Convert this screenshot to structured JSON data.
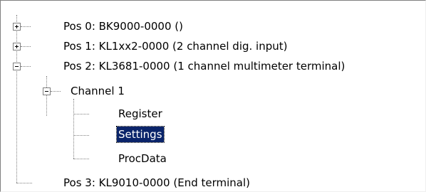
{
  "tree": {
    "nodes": [
      {
        "label": "Pos 0: BK9000-0000  ()",
        "expander": "plus"
      },
      {
        "label": "Pos 1: KL1xx2-0000  (2 channel dig. input)",
        "expander": "plus"
      },
      {
        "label": "Pos 2: KL3681-0000  (1 channel multimeter terminal)",
        "expander": "minus"
      },
      {
        "label": "Channel 1",
        "expander": "minus"
      },
      {
        "label": "Register"
      },
      {
        "label": "Settings",
        "selected": true
      },
      {
        "label": "ProcData"
      },
      {
        "label": "Pos 3: KL9010-0000  (End terminal)"
      }
    ]
  },
  "colors": {
    "selection_bg": "#0a246a",
    "selection_fg": "#ffffff",
    "tree_line": "#808080"
  }
}
